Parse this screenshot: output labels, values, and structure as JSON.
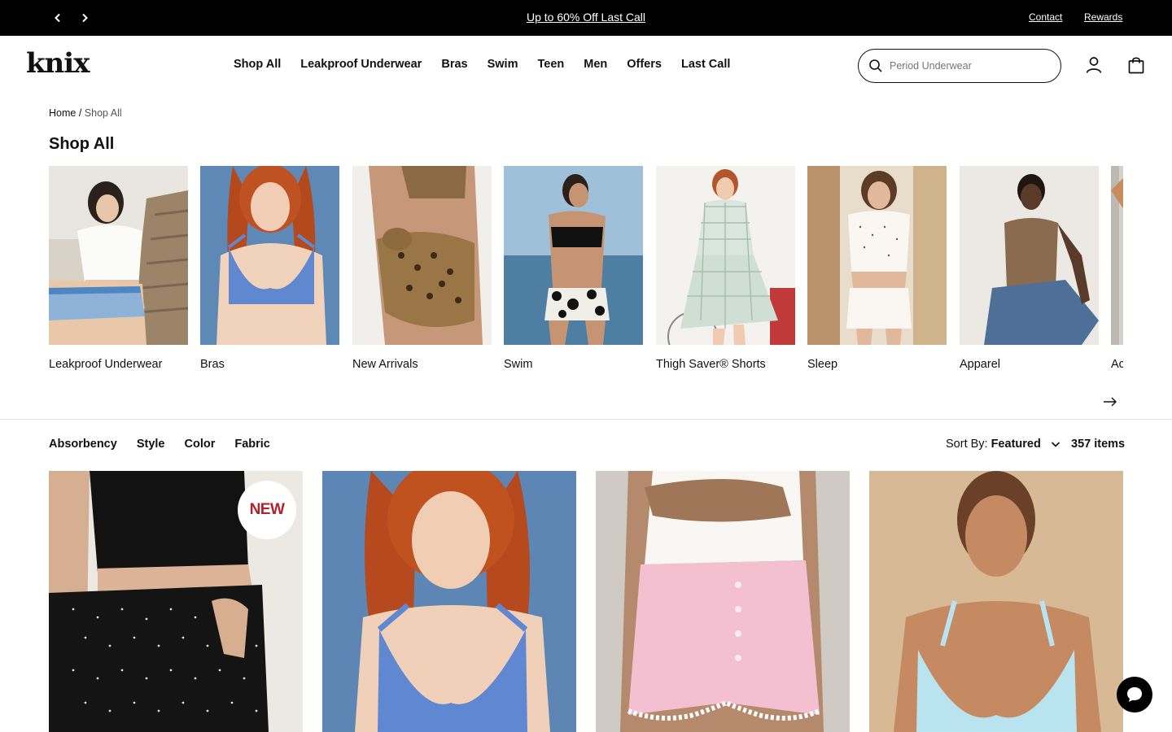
{
  "announcement": {
    "promo_text": "Up to 60% Off Last Call",
    "links": [
      "Contact",
      "Rewards"
    ]
  },
  "header": {
    "logo": "knix",
    "nav": [
      "Shop All",
      "Leakproof Underwear",
      "Bras",
      "Swim",
      "Teen",
      "Men",
      "Offers",
      "Last Call"
    ],
    "search_placeholder": "Period Underwear"
  },
  "breadcrumb": {
    "home": "Home",
    "separator": "/",
    "current": "Shop All"
  },
  "page_title": "Shop All",
  "categories": [
    "Leakproof Underwear",
    "Bras",
    "New Arrivals",
    "Swim",
    "Thigh Saver® Shorts",
    "Sleep",
    "Apparel",
    "Ac"
  ],
  "filters": [
    "Absorbency",
    "Style",
    "Color",
    "Fabric"
  ],
  "sort": {
    "label": "Sort By:",
    "value": "Featured"
  },
  "item_count": "357 items",
  "products": [
    {
      "badge": "NEW"
    },
    {
      "badge": ""
    },
    {
      "badge": ""
    },
    {
      "badge": ""
    }
  ],
  "colors": {
    "topbar": "#000000",
    "badge_text": "#b3222a",
    "text": "#111111"
  },
  "icons": [
    "chevron-left-icon",
    "chevron-right-icon",
    "search-icon",
    "account-icon",
    "bag-icon",
    "arrow-right-icon",
    "chevron-down-icon",
    "chat-icon"
  ]
}
